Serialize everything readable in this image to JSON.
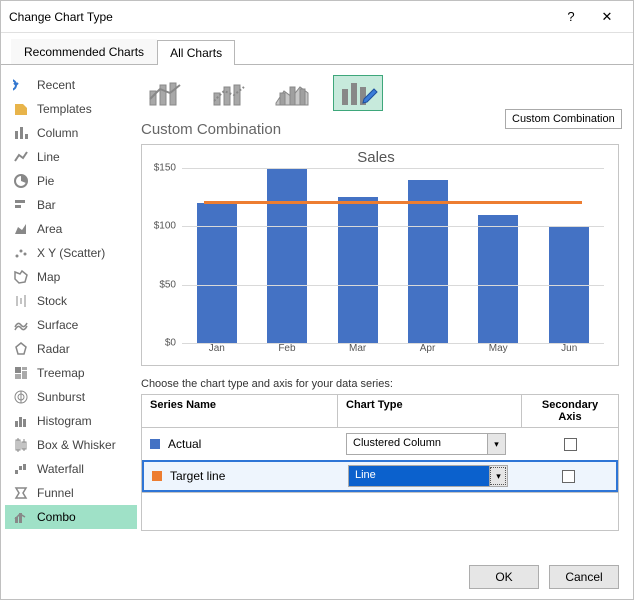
{
  "window": {
    "title": "Change Chart Type",
    "help": "?",
    "close": "✕"
  },
  "tabs": [
    {
      "id": "rec",
      "label": "Recommended Charts"
    },
    {
      "id": "all",
      "label": "All Charts"
    }
  ],
  "sidebar": {
    "items": [
      {
        "label": "Recent"
      },
      {
        "label": "Templates"
      },
      {
        "label": "Column"
      },
      {
        "label": "Line"
      },
      {
        "label": "Pie"
      },
      {
        "label": "Bar"
      },
      {
        "label": "Area"
      },
      {
        "label": "X Y (Scatter)"
      },
      {
        "label": "Map"
      },
      {
        "label": "Stock"
      },
      {
        "label": "Surface"
      },
      {
        "label": "Radar"
      },
      {
        "label": "Treemap"
      },
      {
        "label": "Sunburst"
      },
      {
        "label": "Histogram"
      },
      {
        "label": "Box & Whisker"
      },
      {
        "label": "Waterfall"
      },
      {
        "label": "Funnel"
      },
      {
        "label": "Combo"
      }
    ]
  },
  "main": {
    "section_title": "Custom Combination",
    "tooltip": "Custom Combination",
    "series_label": "Choose the chart type and axis for your data series:",
    "cols": {
      "name": "Series Name",
      "type": "Chart Type",
      "axis": "Secondary Axis"
    },
    "rows": [
      {
        "swatch": "#4472C4",
        "name": "Actual",
        "type": "Clustered Column"
      },
      {
        "swatch": "#ED7D31",
        "name": "Target line",
        "type": "Line"
      }
    ]
  },
  "footer": {
    "ok": "OK",
    "cancel": "Cancel"
  },
  "chart_data": {
    "type": "combo",
    "title": "Sales",
    "categories": [
      "Jan",
      "Feb",
      "Mar",
      "Apr",
      "May",
      "Jun"
    ],
    "series": [
      {
        "name": "Actual",
        "type": "bar",
        "color": "#4472C4",
        "values": [
          120,
          150,
          125,
          140,
          110,
          100
        ]
      },
      {
        "name": "Target line",
        "type": "line",
        "color": "#ED7D31",
        "values": [
          120,
          120,
          120,
          120,
          120,
          120
        ]
      }
    ],
    "ylim": [
      0,
      150
    ],
    "yticks": [
      0,
      50,
      100,
      150
    ]
  }
}
